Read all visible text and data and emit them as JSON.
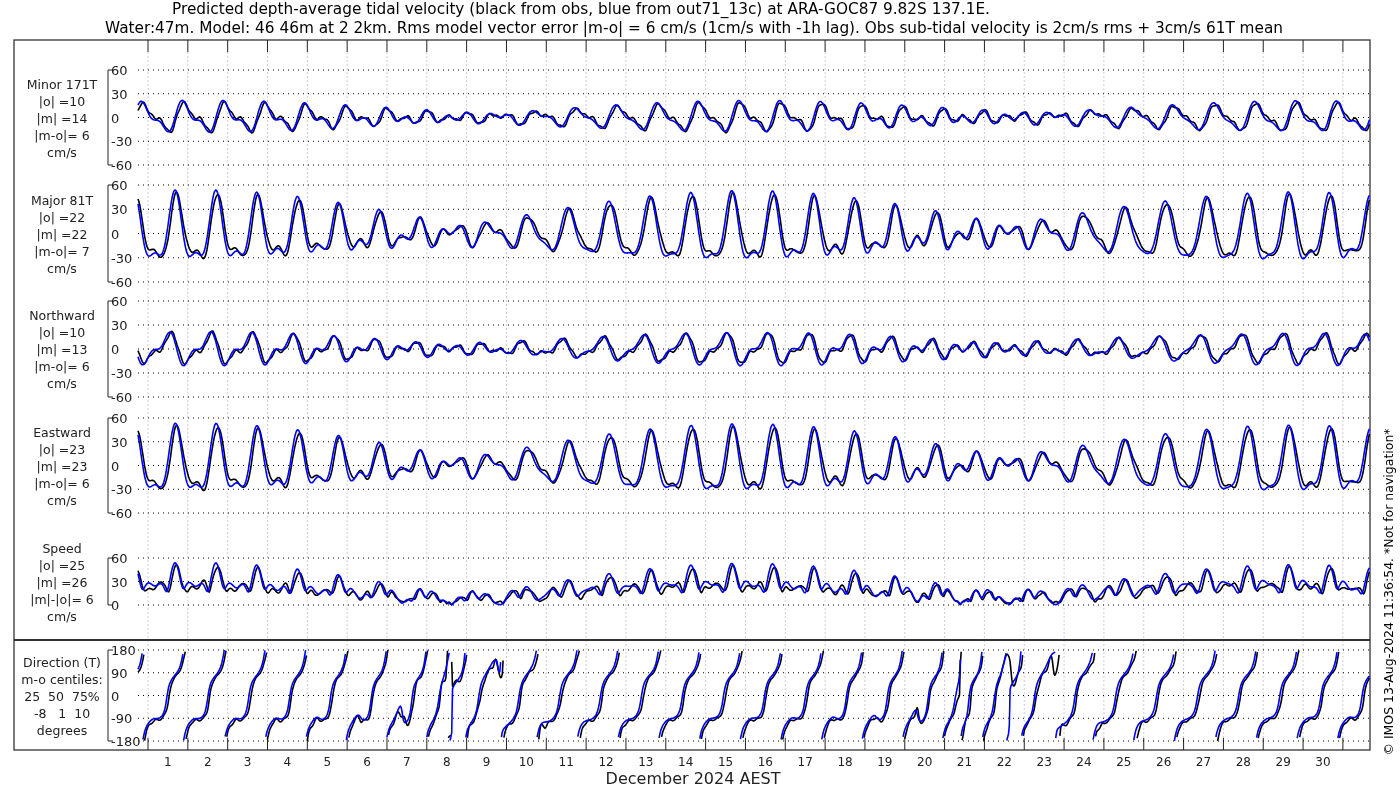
{
  "title": [
    "Predicted depth-average tidal velocity (black from obs, blue from out71_13c) at ARA-GOC87 9.82S 137.1E.",
    "Water:47m. Model: 46 46m at 2 2km. Rms model vector error |m-o| = 6 cm/s (1cm/s with -1h lag). Obs sub-tidal velocity is 2cm/s rms + 3cm/s 61T mean"
  ],
  "series": [
    {
      "color": "#000000"
    },
    {
      "color": "#0000ff"
    }
  ],
  "panels": [
    {
      "kind": "minor",
      "label": [
        "Minor 171T",
        "|o| =10",
        "|m| =14",
        "|m-o|= 6",
        "cm/s"
      ],
      "yticks": [
        "60",
        "30",
        "0",
        "-30",
        "-60"
      ]
    },
    {
      "kind": "major",
      "label": [
        "Major 81T",
        "|o| =22",
        "|m| =22",
        "|m-o|= 7",
        "cm/s"
      ],
      "yticks": [
        "60",
        "30",
        "0",
        "-30",
        "-60"
      ]
    },
    {
      "kind": "north",
      "label": [
        "Northward",
        "|o| =10",
        "|m| =13",
        "|m-o|= 6",
        "cm/s"
      ],
      "yticks": [
        "60",
        "30",
        "0",
        "-30",
        "-60"
      ]
    },
    {
      "kind": "east",
      "label": [
        "Eastward",
        "|o| =23",
        "|m| =23",
        "|m-o|= 6",
        "cm/s"
      ],
      "yticks": [
        "60",
        "30",
        "0",
        "-30",
        "-60"
      ]
    },
    {
      "kind": "speed",
      "label": [
        "Speed",
        "|o| =25",
        "|m| =26",
        "|m|-|o|= 6",
        "cm/s"
      ],
      "yticks": [
        "60",
        "30",
        "0"
      ]
    },
    {
      "kind": "direction",
      "label": [
        "Direction (T)",
        "m-o centiles:",
        "25  50  75%",
        "-8   1  10",
        "degrees"
      ],
      "yticks": [
        "180",
        "90",
        "0",
        "-90",
        "-180"
      ]
    }
  ],
  "x_axis": {
    "day_labels": [
      "1",
      "2",
      "3",
      "4",
      "5",
      "6",
      "7",
      "8",
      "9",
      "10",
      "11",
      "12",
      "13",
      "14",
      "15",
      "16",
      "17",
      "18",
      "19",
      "20",
      "21",
      "22",
      "23",
      "24",
      "25",
      "26",
      "27",
      "28",
      "29",
      "30"
    ],
    "xlabel": "December 2024 AEST"
  },
  "side_note": "© IMOS 13-Aug-2024 11:36:54. *Not for navigation*"
}
